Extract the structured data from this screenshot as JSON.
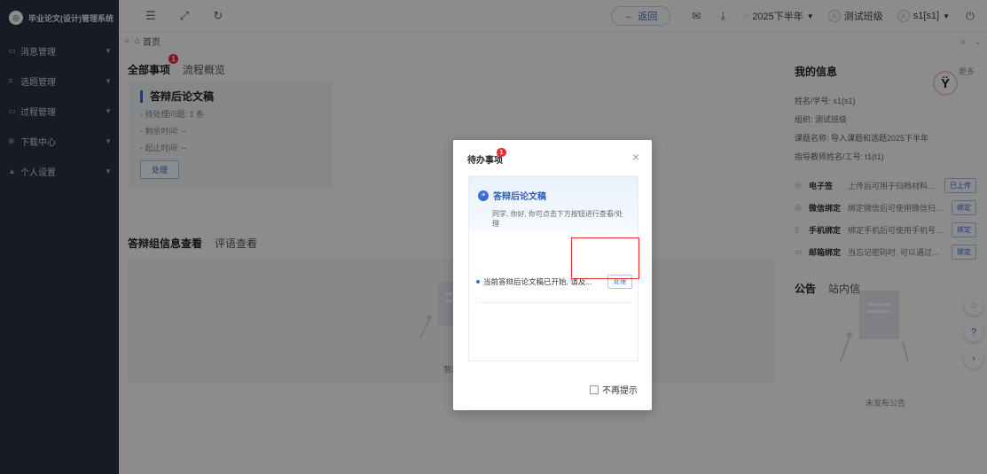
{
  "sidebar": {
    "app_title": "毕业论文(设计)管理系统",
    "items": [
      {
        "icon": "message-icon",
        "label": "消息管理"
      },
      {
        "icon": "list-icon",
        "label": "选题管理"
      },
      {
        "icon": "process-icon",
        "label": "过程管理"
      },
      {
        "icon": "download-icon",
        "label": "下载中心"
      },
      {
        "icon": "user-icon",
        "label": "个人设置"
      }
    ]
  },
  "header": {
    "back_label": "返回",
    "term": "2025下半年",
    "class_name": "测试班级",
    "user": "s1[s1]"
  },
  "tabs": {
    "home": "首页"
  },
  "main": {
    "tab_all": "全部事项",
    "tab_all_badge": "1",
    "tab_flow": "流程概览",
    "todo": {
      "title": "答辩后论文稿",
      "pending": "- 待处理问题: 1 条",
      "remaining": "- 剩余时间: --",
      "deadline": "- 起止时间: --",
      "handle_btn": "处理"
    },
    "group_tab": "答辩组信息查看",
    "review_tab": "评语查看",
    "empty_text": "暂未"
  },
  "right": {
    "title": "我的信息",
    "more": "更多",
    "name_line": "姓名/学号: s1(s1)",
    "org_line": "组织: 测试班级",
    "project_line": "课题名称: 导入课题和选题2025下半年",
    "teacher_line": "指导教师姓名/工号: t1(t1)",
    "bindings": [
      {
        "icon": "signature-icon",
        "name": "电子签",
        "desc": "上传后可用于归档材料导出使用",
        "btn": "已上传"
      },
      {
        "icon": "wechat-icon",
        "name": "微信绑定",
        "desc": "绑定微信后可使用微信扫描二维...",
        "btn": "绑定"
      },
      {
        "icon": "phone-icon",
        "name": "手机绑定",
        "desc": "绑定手机后可使用手机号码登录...",
        "btn": "绑定"
      },
      {
        "icon": "mail-icon",
        "name": "邮箱绑定",
        "desc": "当忘记密码时, 可以通过安全邮...",
        "btn": "绑定"
      }
    ],
    "notice_tab": "公告",
    "inbox_tab": "站内信",
    "empty_notice": "未发布公告"
  },
  "modal": {
    "title": "待办事项",
    "badge": "1",
    "section_title": "答辩后论文稿",
    "section_sub": "同学, 你好, 你可点击下方按钮进行查看/处理",
    "row_text": "当前答辩后论文稿已开始, 请及...",
    "row_btn": "处理",
    "no_remind": "不再提示"
  }
}
